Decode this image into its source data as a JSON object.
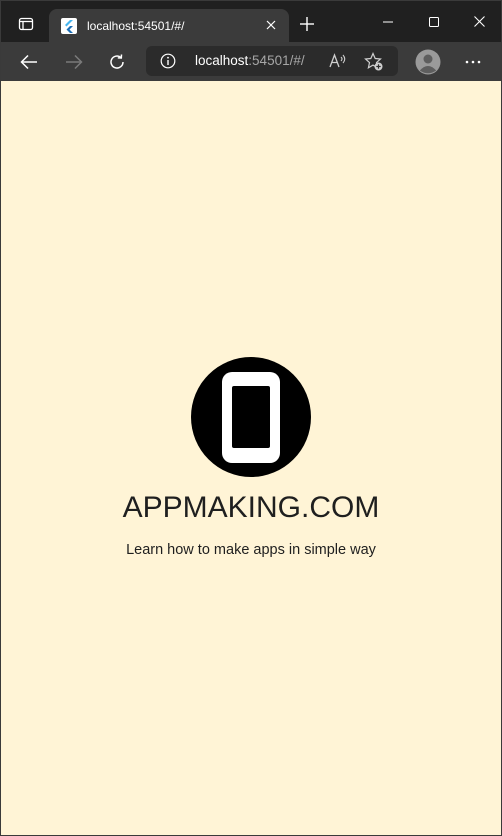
{
  "browser": {
    "tab": {
      "title": "localhost:54501/#/",
      "close_icon": "close-icon"
    },
    "url": {
      "host": "localhost",
      "rest": ":54501/#/"
    },
    "colors": {
      "frame": "#202020",
      "toolbar": "#3b3b3b",
      "address": "#2b2b2b"
    }
  },
  "page": {
    "brand": "APPMAKING.COM",
    "tagline": "Learn how to make apps in simple way",
    "colors": {
      "background": "#fff4d6",
      "logo": "#000000"
    }
  }
}
